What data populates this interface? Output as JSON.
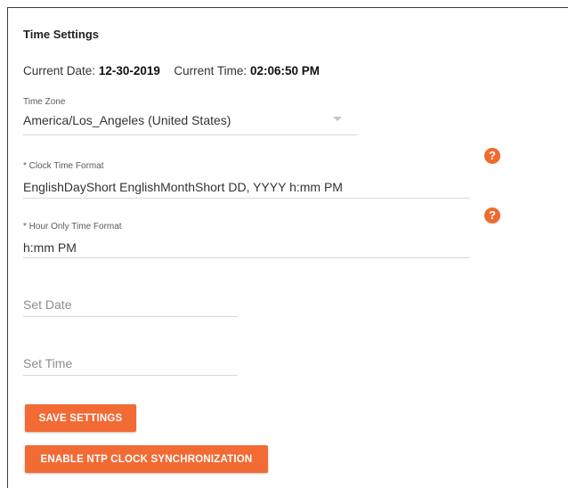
{
  "title": "Time Settings",
  "current": {
    "date_label": "Current Date:",
    "date_value": "12-30-2019",
    "time_label": "Current Time:",
    "time_value": "02:06:50 PM"
  },
  "time_zone": {
    "label": "Time Zone",
    "value": "America/Los_Angeles (United States)"
  },
  "clock_format": {
    "label": "* Clock Time Format",
    "value": "EnglishDayShort EnglishMonthShort DD, YYYY h:mm PM"
  },
  "hour_format": {
    "label": "* Hour Only Time Format",
    "value": "h:mm PM"
  },
  "set_date": {
    "placeholder": "Set Date"
  },
  "set_time": {
    "placeholder": "Set Time"
  },
  "help_glyph": "?",
  "buttons": {
    "save": "SAVE SETTINGS",
    "ntp": "ENABLE NTP CLOCK SYNCHRONIZATION"
  },
  "colors": {
    "accent": "#f26a34",
    "help_icon": "#ee6b2f"
  },
  "icons": {
    "help": "question-circle-icon",
    "dropdown": "caret-down-icon"
  }
}
